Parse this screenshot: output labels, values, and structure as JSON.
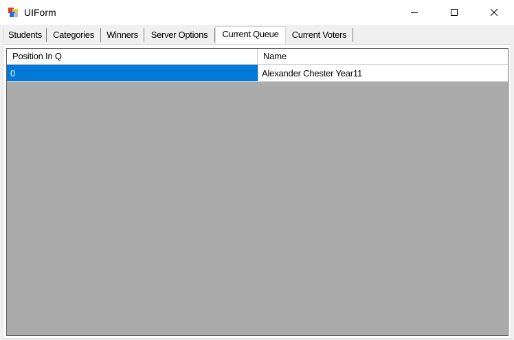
{
  "window": {
    "title": "UIForm",
    "icon": "winforms-app-icon",
    "controls": [
      "minimize-icon",
      "maximize-icon",
      "close-icon"
    ]
  },
  "tabs": [
    {
      "label": "Students",
      "active": false
    },
    {
      "label": "Categories",
      "active": false
    },
    {
      "label": "Winners",
      "active": false
    },
    {
      "label": "Server Options",
      "active": false
    },
    {
      "label": "Current Queue",
      "active": true
    },
    {
      "label": "Current Voters",
      "active": false
    }
  ],
  "grid": {
    "columns": [
      "Position In Q",
      "Name"
    ],
    "rows": [
      {
        "position": "0",
        "name": "Alexander Chester Year11",
        "selected": true
      }
    ]
  },
  "colors": {
    "selection": "#0078d7",
    "grid_background": "#ababab",
    "window_background": "#f0f0f0"
  }
}
